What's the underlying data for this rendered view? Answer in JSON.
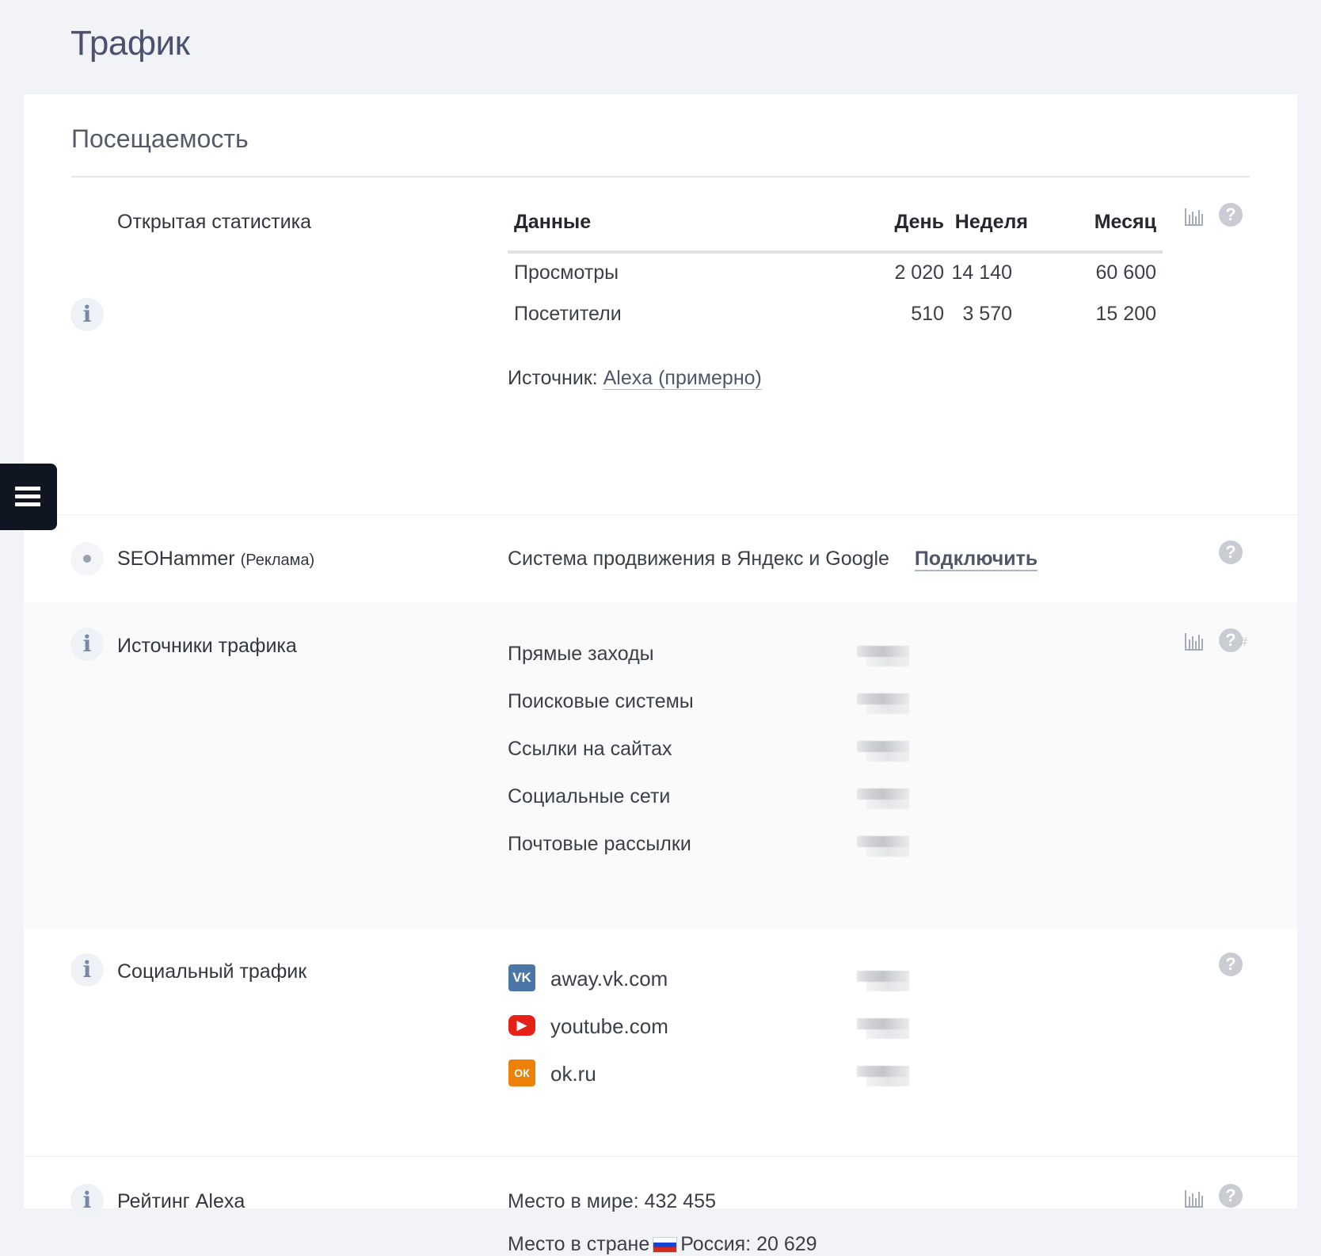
{
  "page": {
    "title": "Трафик"
  },
  "section": {
    "title": "Посещаемость"
  },
  "open_stats": {
    "label": "Открытая статистика",
    "headers": [
      "Данные",
      "День",
      "Неделя",
      "Месяц"
    ],
    "rows": [
      {
        "name": "Просмотры",
        "day": "2 020",
        "week": "14 140",
        "month": "60 600"
      },
      {
        "name": "Посетители",
        "day": "510",
        "week": "3 570",
        "month": "15 200"
      }
    ],
    "source_label": "Источник:",
    "source_link": "Alexa (примерно)"
  },
  "seohammer": {
    "label": "SEOHammer",
    "tag": "(Реклама)",
    "description": "Система продвижения в Яндекс и Google",
    "action": "Подключить"
  },
  "traffic_sources": {
    "label": "Источники трафика",
    "items": [
      "Прямые заходы",
      "Поисковые системы",
      "Ссылки на сайтах",
      "Социальные сети",
      "Почтовые рассылки"
    ],
    "hash_symbol": "#"
  },
  "social_traffic": {
    "label": "Социальный трафик",
    "sites": [
      {
        "name": "away.vk.com",
        "icon": "vk-icon",
        "color": "#4a76a8",
        "glyph": "VK"
      },
      {
        "name": "youtube.com",
        "icon": "youtube-icon",
        "color": "#e62117",
        "glyph": "▶"
      },
      {
        "name": "ok.ru",
        "icon": "ok-icon",
        "color": "#ee8208",
        "glyph": "ОК"
      }
    ]
  },
  "alexa_rank": {
    "label": "Рейтинг Alexa",
    "world_label": "Место в мире:",
    "world_value": "432 455",
    "country_label": "Место в стране",
    "country_value": "Россия: 20 629"
  },
  "icons": {
    "info": "info-icon",
    "chart": "bar-chart-icon",
    "help": "help-icon",
    "menu": "hamburger-menu-icon"
  },
  "help_glyph": "?",
  "info_glyph": "i",
  "colors": {
    "background": "#f1f3f7",
    "card": "#ffffff",
    "title": "#4a5270",
    "menu_fab": "#0f1622"
  }
}
